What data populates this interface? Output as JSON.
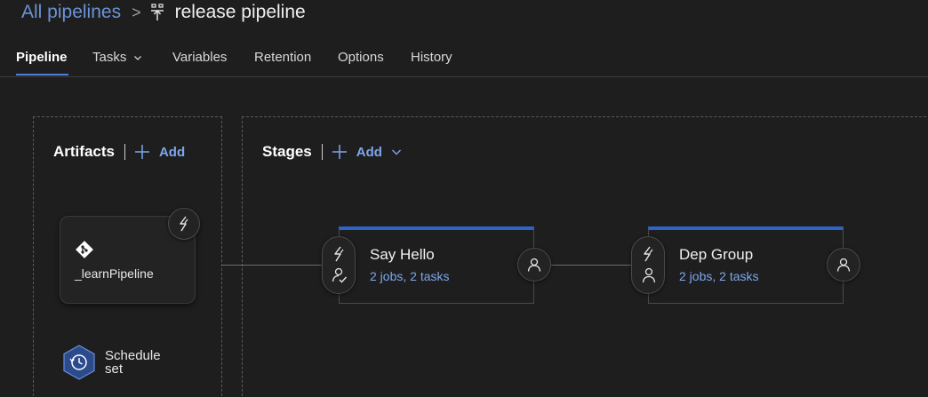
{
  "breadcrumb": {
    "root_label": "All pipelines",
    "separator": ">",
    "current_label": "release pipeline"
  },
  "tabs": [
    {
      "label": "Pipeline",
      "active": true
    },
    {
      "label": "Tasks",
      "active": false,
      "has_dropdown": true
    },
    {
      "label": "Variables",
      "active": false
    },
    {
      "label": "Retention",
      "active": false
    },
    {
      "label": "Options",
      "active": false
    },
    {
      "label": "History",
      "active": false
    }
  ],
  "artifacts": {
    "title": "Artifacts",
    "add_label": "Add",
    "items": [
      {
        "name": "_learnPipeline",
        "icon": "git-icon"
      }
    ],
    "schedule": {
      "line1": "Schedule",
      "line2": "set",
      "icon": "schedule-icon"
    }
  },
  "stages": {
    "title": "Stages",
    "add_label": "Add",
    "items": [
      {
        "name": "Say Hello",
        "summary": "2 jobs, 2 tasks"
      },
      {
        "name": "Dep Group",
        "summary": "2 jobs, 2 tasks"
      }
    ]
  },
  "colors": {
    "background": "#1e1e1e",
    "accent": "#2e63c8",
    "link": "#7ea6ee",
    "breadcrumb_link": "#6a93d8"
  }
}
